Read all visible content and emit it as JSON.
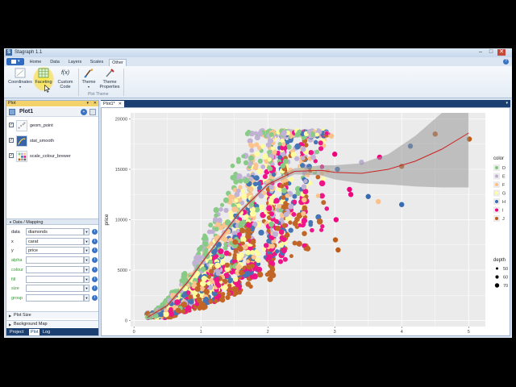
{
  "window": {
    "title": "Stagraph 1.1",
    "app_letter": "S",
    "min": "–",
    "max": "□",
    "close": "✕"
  },
  "ribbon_tabs": [
    "Home",
    "Data",
    "Layers",
    "Scales",
    "Other"
  ],
  "active_tab": "Other",
  "ribbon": {
    "coordinates": "Coordinates",
    "faceting": "Faceting",
    "custom_code_line1": "Custom",
    "custom_code_line2": "Code",
    "custom_code_glyph": "f(x)",
    "theme": "Theme",
    "theme_properties_line1": "Theme",
    "theme_properties_line2": "Properties",
    "group_plot_theme": "Plot Theme"
  },
  "left_panel": {
    "header": "Plot",
    "plot_name": "Plot1",
    "layers": [
      {
        "name": "geom_point",
        "checked": true
      },
      {
        "name": "stat_smooth",
        "checked": true
      },
      {
        "name": "scale_colour_brewer",
        "checked": true
      }
    ],
    "section_mapping": "Data / Mapping",
    "mappings": [
      {
        "label": "data",
        "value": "diamonds",
        "green": false
      },
      {
        "label": "x",
        "value": "carat",
        "green": false
      },
      {
        "label": "y",
        "value": "price",
        "green": false
      },
      {
        "label": "alpha",
        "value": "",
        "green": true
      },
      {
        "label": "colour",
        "value": "",
        "green": true
      },
      {
        "label": "fill",
        "value": "",
        "green": true
      },
      {
        "label": "size",
        "value": "",
        "green": true
      },
      {
        "label": "group",
        "value": "",
        "green": true
      }
    ],
    "section_plot_size": "Plot Size",
    "section_background_map": "Background Map",
    "bottom_tabs": [
      "Project",
      "Plot",
      "Log"
    ],
    "active_bottom_tab": "Plot"
  },
  "document_tab": "Plot1*",
  "chart_data": {
    "type": "scatter",
    "xlabel": "carat",
    "ylabel": "price",
    "xlim": [
      -0.05,
      5.25
    ],
    "ylim": [
      -600,
      20600
    ],
    "xticks": [
      0,
      1,
      2,
      3,
      4,
      5
    ],
    "yticks": [
      0,
      5000,
      10000,
      15000,
      20000
    ],
    "grid": true,
    "legend_position": "right",
    "color_legend": {
      "title": "color",
      "entries": [
        {
          "label": "D",
          "color": "#7fc97f"
        },
        {
          "label": "E",
          "color": "#beaed4"
        },
        {
          "label": "F",
          "color": "#fdc086"
        },
        {
          "label": "G",
          "color": "#ffff99"
        },
        {
          "label": "H",
          "color": "#386cb0"
        },
        {
          "label": "I",
          "color": "#f0027f"
        },
        {
          "label": "J",
          "color": "#bf5b17"
        }
      ]
    },
    "size_legend": {
      "title": "depth",
      "entries": [
        {
          "label": "50",
          "size": 50
        },
        {
          "label": "60",
          "size": 60
        },
        {
          "label": "70",
          "size": 70
        }
      ]
    },
    "smooth": {
      "color": "#cc2222",
      "x": [
        0.2,
        0.5,
        0.8,
        1.0,
        1.3,
        1.6,
        2.0,
        2.4,
        2.8,
        3.0,
        3.4,
        3.8,
        4.2,
        4.6,
        5.0
      ],
      "y": [
        300,
        1500,
        3800,
        5600,
        8300,
        10900,
        13500,
        14800,
        14900,
        14700,
        14600,
        15000,
        15800,
        17000,
        18600
      ],
      "ci_low": [
        0,
        1300,
        3600,
        5400,
        8100,
        10700,
        13300,
        14500,
        14400,
        14000,
        13600,
        13500,
        13300,
        13200,
        13200
      ],
      "ci_high": [
        600,
        1700,
        4000,
        5800,
        8500,
        11100,
        13700,
        15100,
        15400,
        15400,
        15600,
        16500,
        18300,
        20800,
        20800
      ]
    },
    "highlighted_points": [
      {
        "x": 5.01,
        "y": 18000,
        "color": "#bf5b17"
      },
      {
        "x": 4.5,
        "y": 18500,
        "color": "#bf5b17"
      },
      {
        "x": 4.13,
        "y": 17300,
        "color": "#386cb0"
      },
      {
        "x": 4.0,
        "y": 15300,
        "color": "#bf5b17"
      },
      {
        "x": 3.67,
        "y": 16200,
        "color": "#f0027f"
      },
      {
        "x": 3.65,
        "y": 11800,
        "color": "#fdc086"
      },
      {
        "x": 3.4,
        "y": 15700,
        "color": "#beaed4"
      },
      {
        "x": 3.24,
        "y": 12500,
        "color": "#f0027f"
      },
      {
        "x": 3.04,
        "y": 15000,
        "color": "#386cb0"
      },
      {
        "x": 3.01,
        "y": 8000,
        "color": "#bf5b17"
      },
      {
        "x": 3.22,
        "y": 13000,
        "color": "#f0027f"
      },
      {
        "x": 3.5,
        "y": 12300,
        "color": "#386cb0"
      },
      {
        "x": 3.0,
        "y": 16500,
        "color": "#f0027f"
      },
      {
        "x": 3.02,
        "y": 10000,
        "color": "#f0027f"
      },
      {
        "x": 3.05,
        "y": 7000,
        "color": "#bf5b17"
      },
      {
        "x": 4.0,
        "y": 11500,
        "color": "#386cb0"
      },
      {
        "x": 2.95,
        "y": 18300,
        "color": "#fdc086"
      }
    ]
  },
  "colors": {
    "accent": "#1b3f70",
    "panel_background": "#ebebeb",
    "grid": "#ffffff"
  }
}
